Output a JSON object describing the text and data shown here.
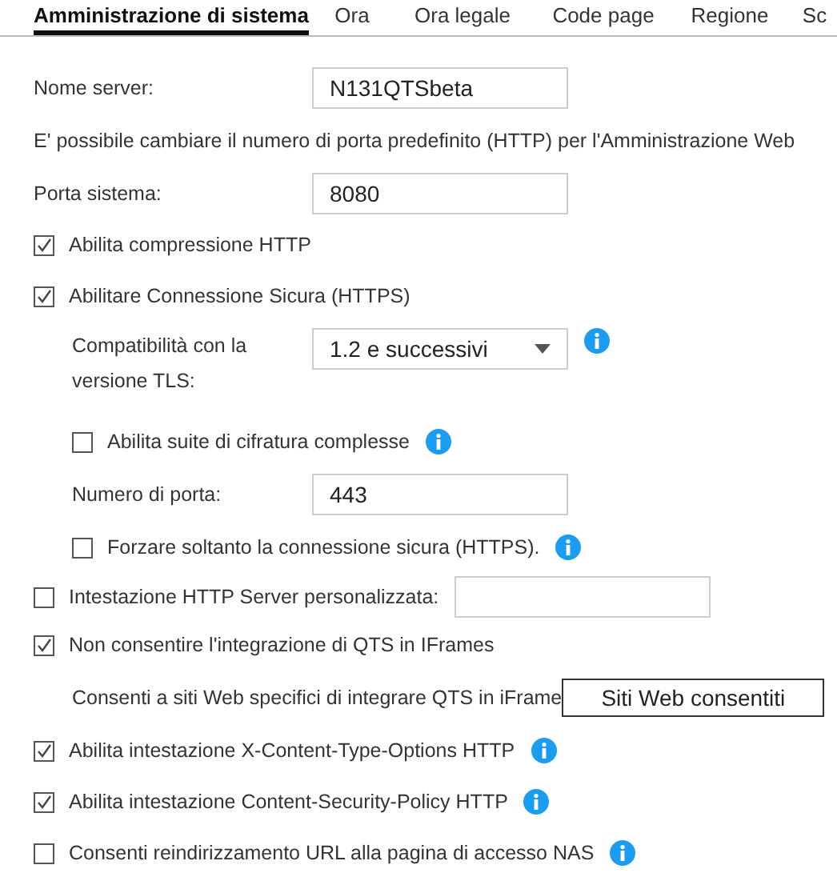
{
  "tabs": [
    {
      "label": "Amministrazione di sistema",
      "selected": true
    },
    {
      "label": "Ora",
      "selected": false
    },
    {
      "label": "Ora legale",
      "selected": false
    },
    {
      "label": "Code page",
      "selected": false
    },
    {
      "label": "Regione",
      "selected": false
    },
    {
      "label": "Sc",
      "selected": false
    }
  ],
  "rows": [
    {
      "kind": "field",
      "label": "Nome server:",
      "value": "N131QTSbeta",
      "indented": false
    },
    {
      "kind": "note",
      "text": "E' possibile cambiare il numero di porta predefinito (HTTP) per l'Amministrazione Web"
    },
    {
      "kind": "field",
      "label": "Porta sistema:",
      "value": "8080",
      "indented": false
    },
    {
      "kind": "checkbox",
      "label": "Abilita compressione HTTP",
      "checked": true,
      "indented": false,
      "info": false
    },
    {
      "kind": "checkbox",
      "label": "Abilitare Connessione Sicura (HTTPS)",
      "checked": true,
      "indented": false,
      "info": false
    },
    {
      "kind": "select",
      "label": "Compatibilità con la versione TLS:",
      "value": "1.2 e successivi",
      "info": true
    },
    {
      "kind": "checkbox",
      "label": "Abilita suite di cifratura complesse",
      "checked": false,
      "indented": true,
      "info": true
    },
    {
      "kind": "field",
      "label": "Numero di porta:",
      "value": "443",
      "indented": true
    },
    {
      "kind": "checkbox",
      "label": "Forzare soltanto la connessione sicura (HTTPS).",
      "checked": false,
      "indented": true,
      "info": true
    },
    {
      "kind": "checkbox_field",
      "label": "Intestazione HTTP Server personalizzata:",
      "checked": false
    },
    {
      "kind": "checkbox",
      "label": "Non consentire l'integrazione di QTS in IFrames",
      "checked": true,
      "indented": false,
      "info": false
    },
    {
      "kind": "button_row",
      "text": "Consenti a siti Web specifici di integrare QTS in iFrame",
      "button": "Siti Web consentiti"
    },
    {
      "kind": "checkbox",
      "label": "Abilita intestazione X-Content-Type-Options HTTP",
      "checked": true,
      "indented": false,
      "info": true
    },
    {
      "kind": "checkbox",
      "label": "Abilita intestazione Content-Security-Policy HTTP",
      "checked": true,
      "indented": false,
      "info": true
    },
    {
      "kind": "checkbox",
      "label": "Consenti reindirizzamento URL alla pagina di accesso NAS",
      "checked": false,
      "indented": false,
      "info": true
    }
  ]
}
